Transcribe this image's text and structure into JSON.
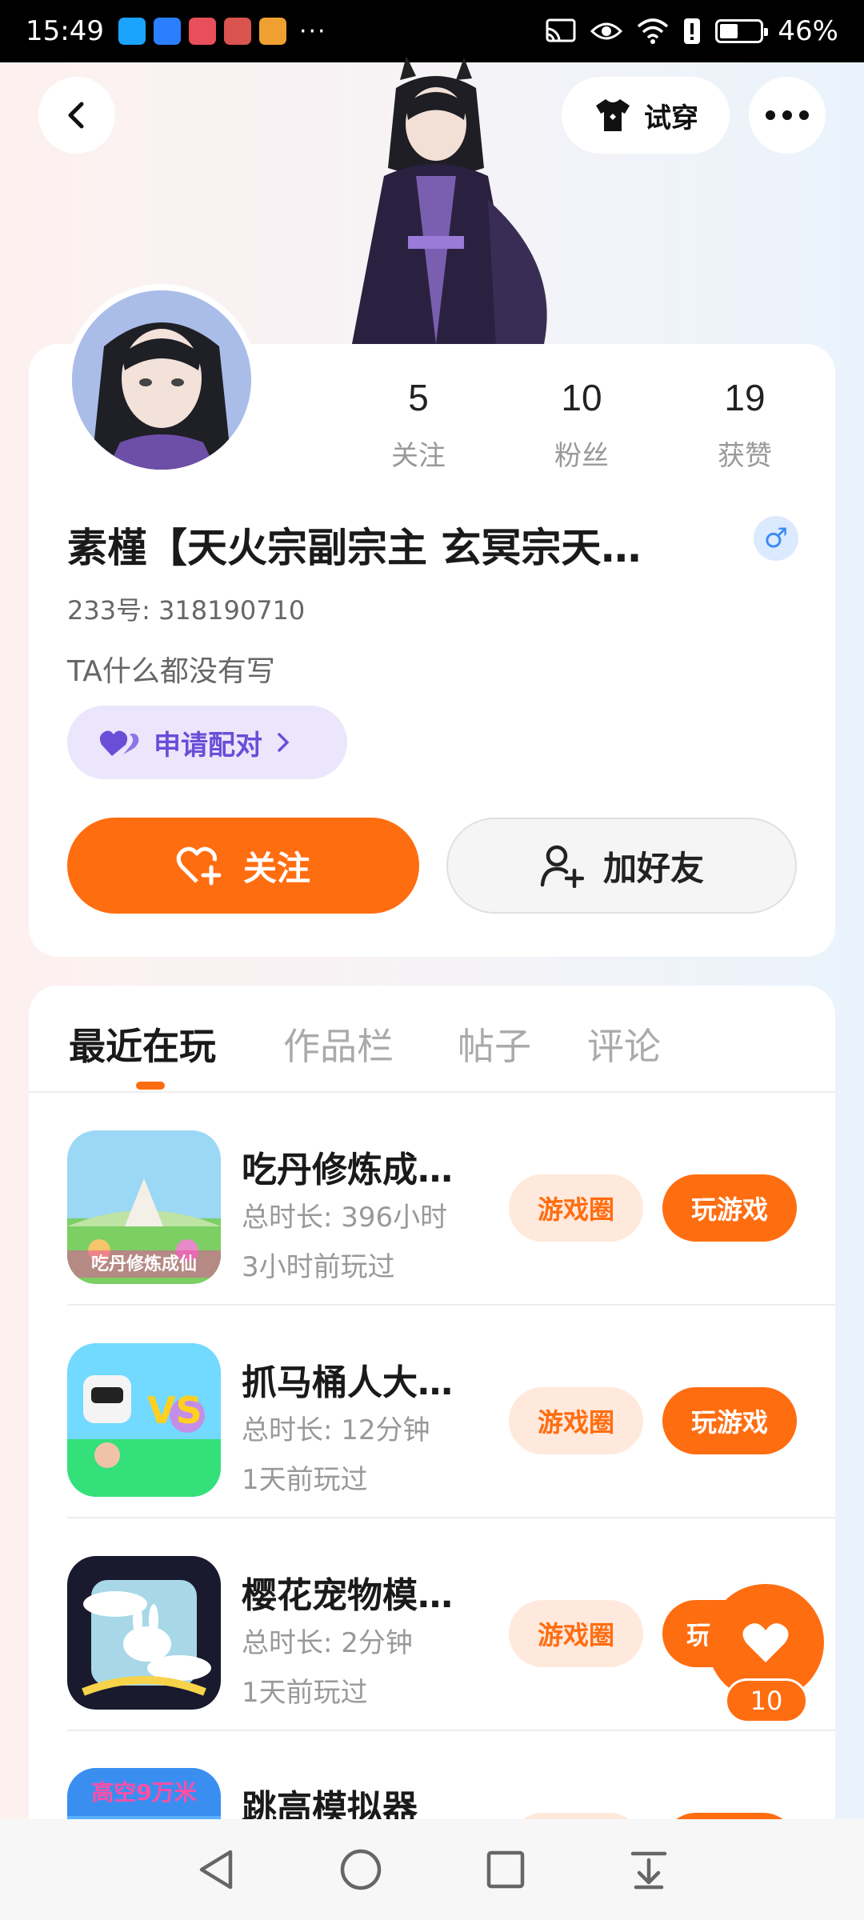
{
  "status_bar": {
    "time": "15:49",
    "overflow": "···",
    "battery": "46%",
    "app_colors": [
      "#1aa3ff",
      "#2b7fff",
      "#e84f5a",
      "#d9534f",
      "#f0a030"
    ]
  },
  "header": {
    "tryon_label": "试穿",
    "back_icon": "chevron-left-icon",
    "more_icon": "more-horizontal-icon"
  },
  "stats": [
    {
      "value": "5",
      "label": "关注"
    },
    {
      "value": "10",
      "label": "粉丝"
    },
    {
      "value": "19",
      "label": "获赞"
    }
  ],
  "profile": {
    "nickname": "素槿【天火宗副宗主 玄冥宗天…",
    "gender": "♂",
    "uid": "233号: 318190710",
    "bio": "TA什么都没有写",
    "pair_label": "申请配对",
    "follow_label": "关注",
    "add_friend_label": "加好友"
  },
  "tabs": [
    {
      "label": "最近在玩",
      "active": true
    },
    {
      "label": "作品栏",
      "active": false
    },
    {
      "label": "帖子",
      "active": false
    },
    {
      "label": "评论",
      "active": false
    }
  ],
  "games": [
    {
      "title": "吃丹修炼成…",
      "duration": "总时长: 396小时",
      "last_played": "3小时前玩过",
      "circle_label": "游戏圈",
      "play_label": "玩游戏",
      "icon_text": "吃丹修炼成仙"
    },
    {
      "title": "抓马桶人大…",
      "duration": "总时长: 12分钟",
      "last_played": "1天前玩过",
      "circle_label": "游戏圈",
      "play_label": "玩游戏",
      "icon_text": "VS"
    },
    {
      "title": "樱花宠物模…",
      "duration": "总时长: 2分钟",
      "last_played": "1天前玩过",
      "circle_label": "游戏圈",
      "play_label": "玩",
      "icon_text": ""
    },
    {
      "title": "跳高模拟器",
      "duration": "",
      "last_played": "",
      "circle_label": "",
      "play_label": "",
      "icon_text": "高空9万米"
    }
  ],
  "floating_like": {
    "count": "10"
  },
  "colors": {
    "accent": "#ff6d11",
    "pair": "#6a4ed8",
    "gender": "#3b8df0"
  }
}
